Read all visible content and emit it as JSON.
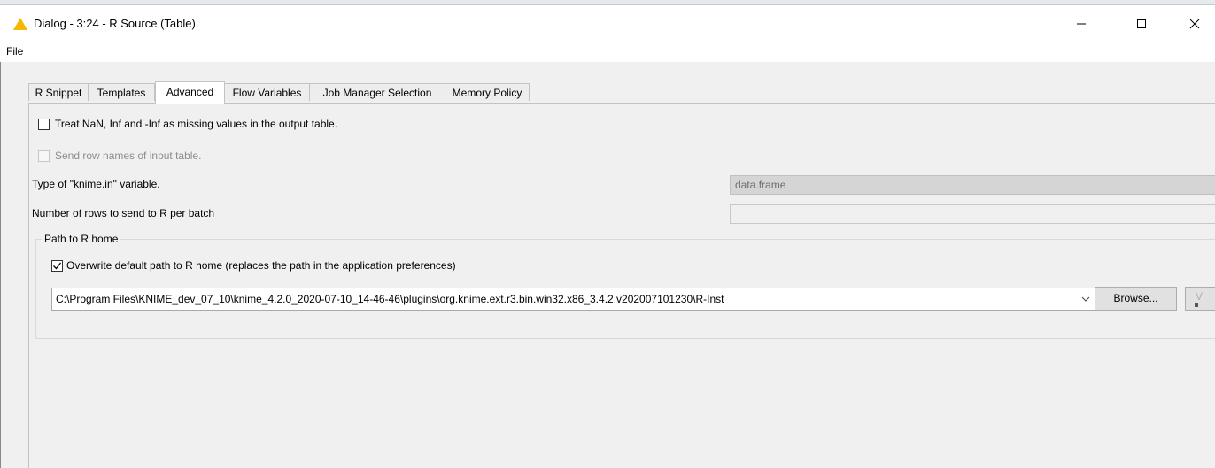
{
  "window": {
    "title": "Dialog - 3:24 - R Source (Table)",
    "minimize_glyph": "—",
    "maximize_glyph": "☐",
    "close_glyph": "✕"
  },
  "menu": {
    "file": "File"
  },
  "tabs": [
    {
      "label": "R Snippet",
      "active": false
    },
    {
      "label": "Templates",
      "active": false
    },
    {
      "label": "Advanced",
      "active": true
    },
    {
      "label": "Flow Variables",
      "active": false
    },
    {
      "label": "Job Manager Selection",
      "active": false
    },
    {
      "label": "Memory Policy",
      "active": false
    }
  ],
  "advanced": {
    "treat_nan": {
      "label": "Treat NaN, Inf and -Inf as missing values in the output table.",
      "checked": false
    },
    "send_row_names": {
      "label": "Send row names of input table.",
      "checked": false,
      "enabled": false
    },
    "knime_in_type": {
      "label": "Type of \"knime.in\" variable.",
      "value": "data.frame"
    },
    "rows_per_batch": {
      "label": "Number of rows to send to R per batch",
      "value": ""
    },
    "r_home": {
      "group_title": "Path to R home",
      "overwrite": {
        "label": "Overwrite default path to R home (replaces the path in the application preferences)",
        "checked": true
      },
      "path": "C:\\Program Files\\KNIME_dev_07_10\\knime_4.2.0_2020-07-10_14-46-46\\plugins\\org.knime.ext.r3.bin.win32.x86_3.4.2.v202007101230\\R-Inst",
      "browse_label": "Browse..."
    }
  },
  "colors": {
    "warning_icon": "#f5b800",
    "panel_bg": "#f0f0f0",
    "disabled_field": "#d5d5d5"
  },
  "icons": {
    "title": "warning-icon",
    "combo": "chevron-down-icon",
    "var": "flow-variable-icon"
  }
}
